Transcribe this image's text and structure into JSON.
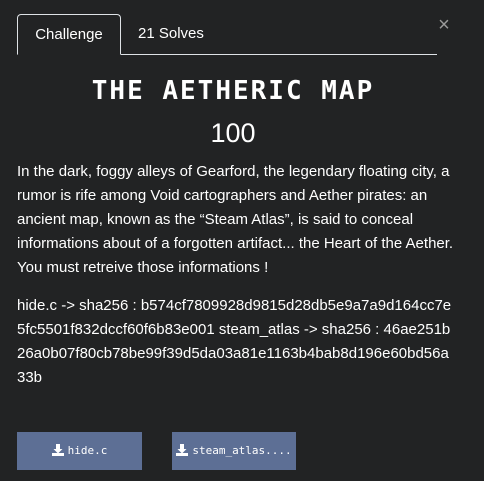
{
  "tabs": [
    {
      "label": "Challenge"
    },
    {
      "label": "21 Solves"
    }
  ],
  "close_glyph": "×",
  "challenge": {
    "name": "THE AETHERIC MAP",
    "value": "100",
    "description": "In the dark, foggy alleys of Gearford, the legendary floating city, a rumor is rife among Void cartographers and Aether pirates: an ancient map, known as the “Steam Atlas”, is said to conceal informations about of a forgotten artifact... the Heart of the Aether. You must retreive those informations !",
    "hashes": "hide.c -> sha256 : b574cf7809928d9815d28db5e9a7a9d164cc7e5fc5501f832dccf60f6b83e001 steam_atlas -> sha256 : 46ae251b26a0b07f80cb78be99f39d5da03a81e1163b4bab8d196e60bd56a33b"
  },
  "files": [
    {
      "label": "hide.c",
      "icon": "download-icon"
    },
    {
      "label": "steam_atlas....",
      "icon": "download-icon"
    }
  ],
  "colors": {
    "background": "#222324",
    "file_button": "#5d6f95"
  }
}
